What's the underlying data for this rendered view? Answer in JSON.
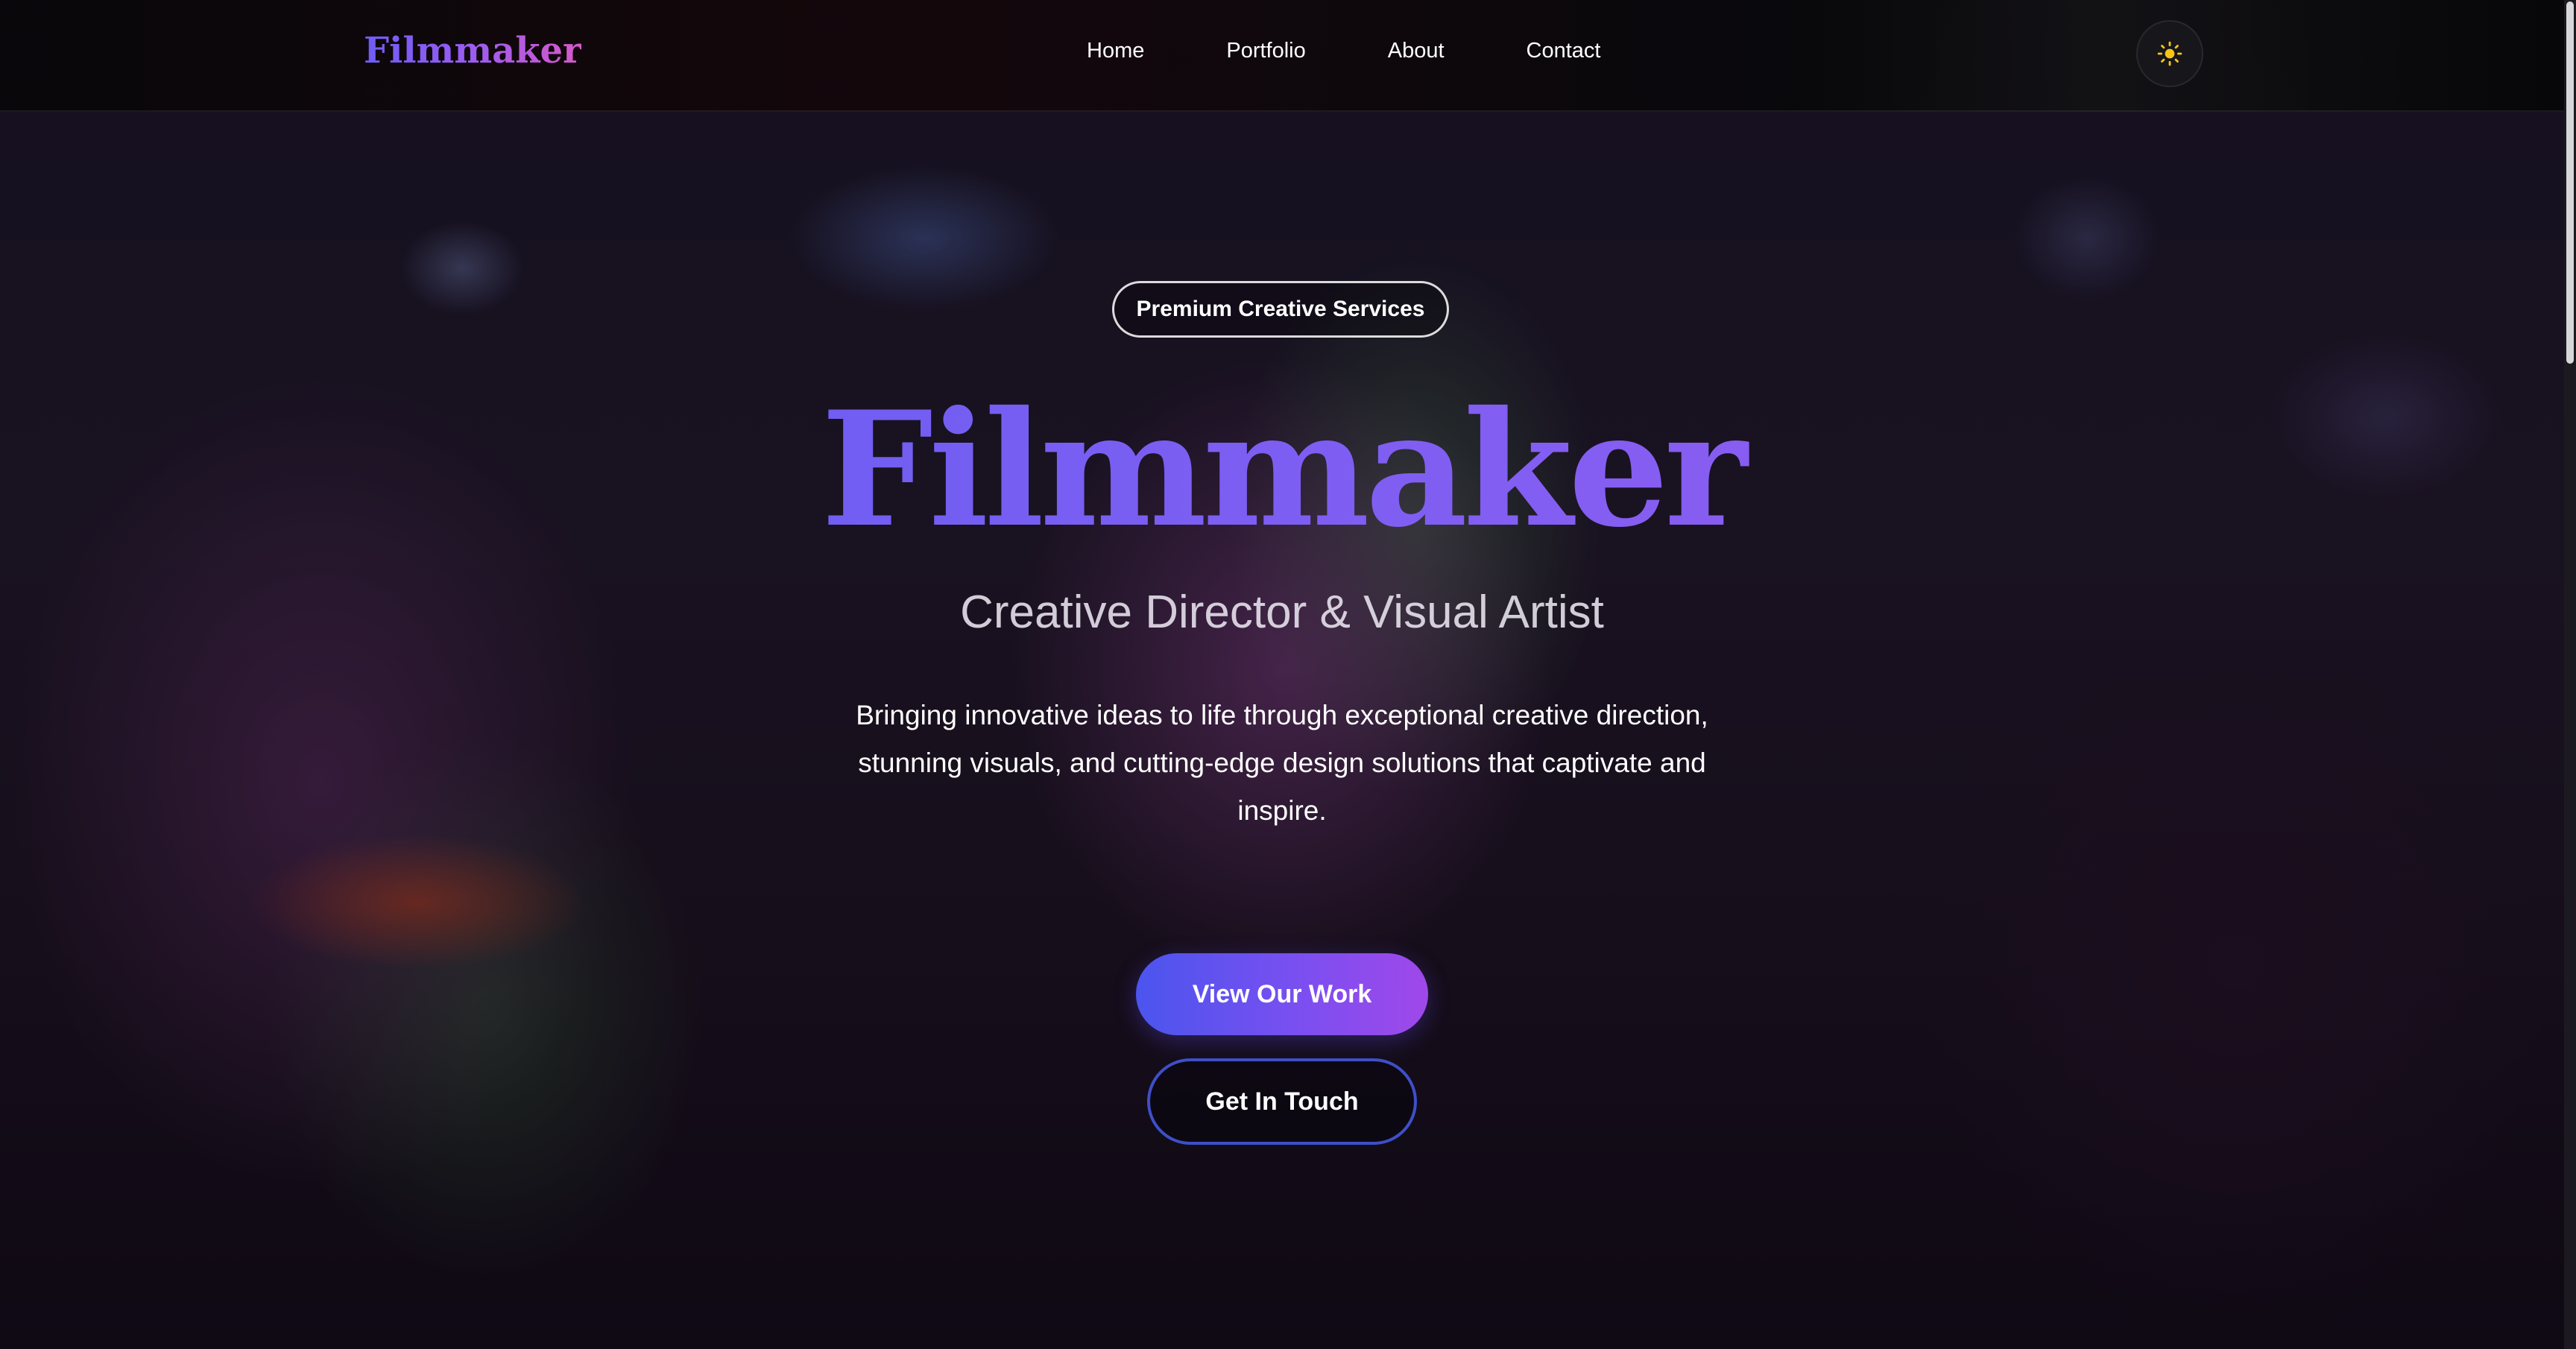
{
  "navbar": {
    "logo": "Filmmaker",
    "links": [
      {
        "label": "Home"
      },
      {
        "label": "Portfolio"
      },
      {
        "label": "About"
      },
      {
        "label": "Contact"
      }
    ],
    "theme_toggle_icon": "sun-icon"
  },
  "hero": {
    "badge": "Premium Creative Services",
    "title": "Filmmaker",
    "subtitle": "Creative Director & Visual Artist",
    "description": "Bringing innovative ideas to life through exceptional creative direction, stunning visuals, and cutting-edge design solutions that captivate and inspire.",
    "primary_button": "View Our Work",
    "secondary_button": "Get In Touch"
  },
  "colors": {
    "accent_start": "#4b55ee",
    "accent_end": "#a048ea",
    "logo_pink": "#d659c9",
    "sun_yellow": "#f5c518",
    "outline_button_border": "#3e4fc8"
  }
}
